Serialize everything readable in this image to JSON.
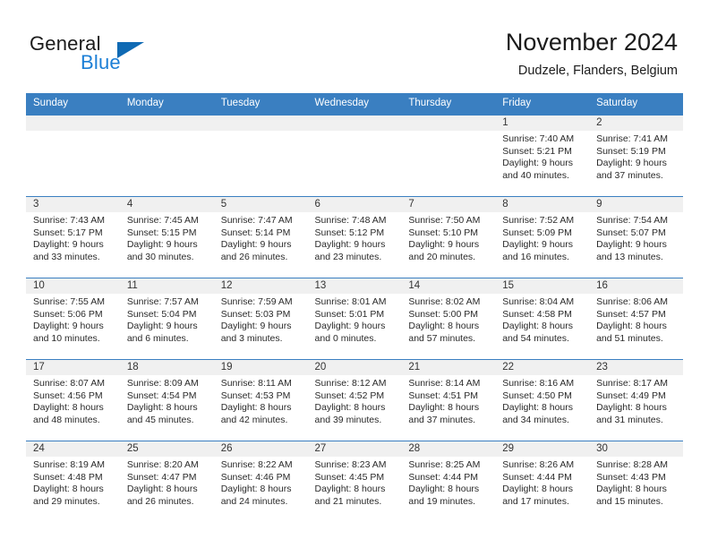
{
  "brand": {
    "word_general": "General",
    "word_blue": "Blue",
    "logo_icon": "triangle-logo-icon"
  },
  "header": {
    "title": "November 2024",
    "subtitle": "Dudzele, Flanders, Belgium"
  },
  "colors": {
    "header_blue": "#3a7fc1",
    "daynum_strip": "#f0f0f0",
    "brand_blue": "#1c7fd6",
    "logo_blue": "#0f6ab4",
    "text": "#222222"
  },
  "calendar": {
    "weekday_headers": [
      "Sunday",
      "Monday",
      "Tuesday",
      "Wednesday",
      "Thursday",
      "Friday",
      "Saturday"
    ],
    "weeks": [
      [
        {
          "day": "",
          "sunrise": "",
          "sunset": "",
          "daylight": ""
        },
        {
          "day": "",
          "sunrise": "",
          "sunset": "",
          "daylight": ""
        },
        {
          "day": "",
          "sunrise": "",
          "sunset": "",
          "daylight": ""
        },
        {
          "day": "",
          "sunrise": "",
          "sunset": "",
          "daylight": ""
        },
        {
          "day": "",
          "sunrise": "",
          "sunset": "",
          "daylight": ""
        },
        {
          "day": "1",
          "sunrise": "Sunrise: 7:40 AM",
          "sunset": "Sunset: 5:21 PM",
          "daylight": "Daylight: 9 hours and 40 minutes."
        },
        {
          "day": "2",
          "sunrise": "Sunrise: 7:41 AM",
          "sunset": "Sunset: 5:19 PM",
          "daylight": "Daylight: 9 hours and 37 minutes."
        }
      ],
      [
        {
          "day": "3",
          "sunrise": "Sunrise: 7:43 AM",
          "sunset": "Sunset: 5:17 PM",
          "daylight": "Daylight: 9 hours and 33 minutes."
        },
        {
          "day": "4",
          "sunrise": "Sunrise: 7:45 AM",
          "sunset": "Sunset: 5:15 PM",
          "daylight": "Daylight: 9 hours and 30 minutes."
        },
        {
          "day": "5",
          "sunrise": "Sunrise: 7:47 AM",
          "sunset": "Sunset: 5:14 PM",
          "daylight": "Daylight: 9 hours and 26 minutes."
        },
        {
          "day": "6",
          "sunrise": "Sunrise: 7:48 AM",
          "sunset": "Sunset: 5:12 PM",
          "daylight": "Daylight: 9 hours and 23 minutes."
        },
        {
          "day": "7",
          "sunrise": "Sunrise: 7:50 AM",
          "sunset": "Sunset: 5:10 PM",
          "daylight": "Daylight: 9 hours and 20 minutes."
        },
        {
          "day": "8",
          "sunrise": "Sunrise: 7:52 AM",
          "sunset": "Sunset: 5:09 PM",
          "daylight": "Daylight: 9 hours and 16 minutes."
        },
        {
          "day": "9",
          "sunrise": "Sunrise: 7:54 AM",
          "sunset": "Sunset: 5:07 PM",
          "daylight": "Daylight: 9 hours and 13 minutes."
        }
      ],
      [
        {
          "day": "10",
          "sunrise": "Sunrise: 7:55 AM",
          "sunset": "Sunset: 5:06 PM",
          "daylight": "Daylight: 9 hours and 10 minutes."
        },
        {
          "day": "11",
          "sunrise": "Sunrise: 7:57 AM",
          "sunset": "Sunset: 5:04 PM",
          "daylight": "Daylight: 9 hours and 6 minutes."
        },
        {
          "day": "12",
          "sunrise": "Sunrise: 7:59 AM",
          "sunset": "Sunset: 5:03 PM",
          "daylight": "Daylight: 9 hours and 3 minutes."
        },
        {
          "day": "13",
          "sunrise": "Sunrise: 8:01 AM",
          "sunset": "Sunset: 5:01 PM",
          "daylight": "Daylight: 9 hours and 0 minutes."
        },
        {
          "day": "14",
          "sunrise": "Sunrise: 8:02 AM",
          "sunset": "Sunset: 5:00 PM",
          "daylight": "Daylight: 8 hours and 57 minutes."
        },
        {
          "day": "15",
          "sunrise": "Sunrise: 8:04 AM",
          "sunset": "Sunset: 4:58 PM",
          "daylight": "Daylight: 8 hours and 54 minutes."
        },
        {
          "day": "16",
          "sunrise": "Sunrise: 8:06 AM",
          "sunset": "Sunset: 4:57 PM",
          "daylight": "Daylight: 8 hours and 51 minutes."
        }
      ],
      [
        {
          "day": "17",
          "sunrise": "Sunrise: 8:07 AM",
          "sunset": "Sunset: 4:56 PM",
          "daylight": "Daylight: 8 hours and 48 minutes."
        },
        {
          "day": "18",
          "sunrise": "Sunrise: 8:09 AM",
          "sunset": "Sunset: 4:54 PM",
          "daylight": "Daylight: 8 hours and 45 minutes."
        },
        {
          "day": "19",
          "sunrise": "Sunrise: 8:11 AM",
          "sunset": "Sunset: 4:53 PM",
          "daylight": "Daylight: 8 hours and 42 minutes."
        },
        {
          "day": "20",
          "sunrise": "Sunrise: 8:12 AM",
          "sunset": "Sunset: 4:52 PM",
          "daylight": "Daylight: 8 hours and 39 minutes."
        },
        {
          "day": "21",
          "sunrise": "Sunrise: 8:14 AM",
          "sunset": "Sunset: 4:51 PM",
          "daylight": "Daylight: 8 hours and 37 minutes."
        },
        {
          "day": "22",
          "sunrise": "Sunrise: 8:16 AM",
          "sunset": "Sunset: 4:50 PM",
          "daylight": "Daylight: 8 hours and 34 minutes."
        },
        {
          "day": "23",
          "sunrise": "Sunrise: 8:17 AM",
          "sunset": "Sunset: 4:49 PM",
          "daylight": "Daylight: 8 hours and 31 minutes."
        }
      ],
      [
        {
          "day": "24",
          "sunrise": "Sunrise: 8:19 AM",
          "sunset": "Sunset: 4:48 PM",
          "daylight": "Daylight: 8 hours and 29 minutes."
        },
        {
          "day": "25",
          "sunrise": "Sunrise: 8:20 AM",
          "sunset": "Sunset: 4:47 PM",
          "daylight": "Daylight: 8 hours and 26 minutes."
        },
        {
          "day": "26",
          "sunrise": "Sunrise: 8:22 AM",
          "sunset": "Sunset: 4:46 PM",
          "daylight": "Daylight: 8 hours and 24 minutes."
        },
        {
          "day": "27",
          "sunrise": "Sunrise: 8:23 AM",
          "sunset": "Sunset: 4:45 PM",
          "daylight": "Daylight: 8 hours and 21 minutes."
        },
        {
          "day": "28",
          "sunrise": "Sunrise: 8:25 AM",
          "sunset": "Sunset: 4:44 PM",
          "daylight": "Daylight: 8 hours and 19 minutes."
        },
        {
          "day": "29",
          "sunrise": "Sunrise: 8:26 AM",
          "sunset": "Sunset: 4:44 PM",
          "daylight": "Daylight: 8 hours and 17 minutes."
        },
        {
          "day": "30",
          "sunrise": "Sunrise: 8:28 AM",
          "sunset": "Sunset: 4:43 PM",
          "daylight": "Daylight: 8 hours and 15 minutes."
        }
      ]
    ]
  }
}
